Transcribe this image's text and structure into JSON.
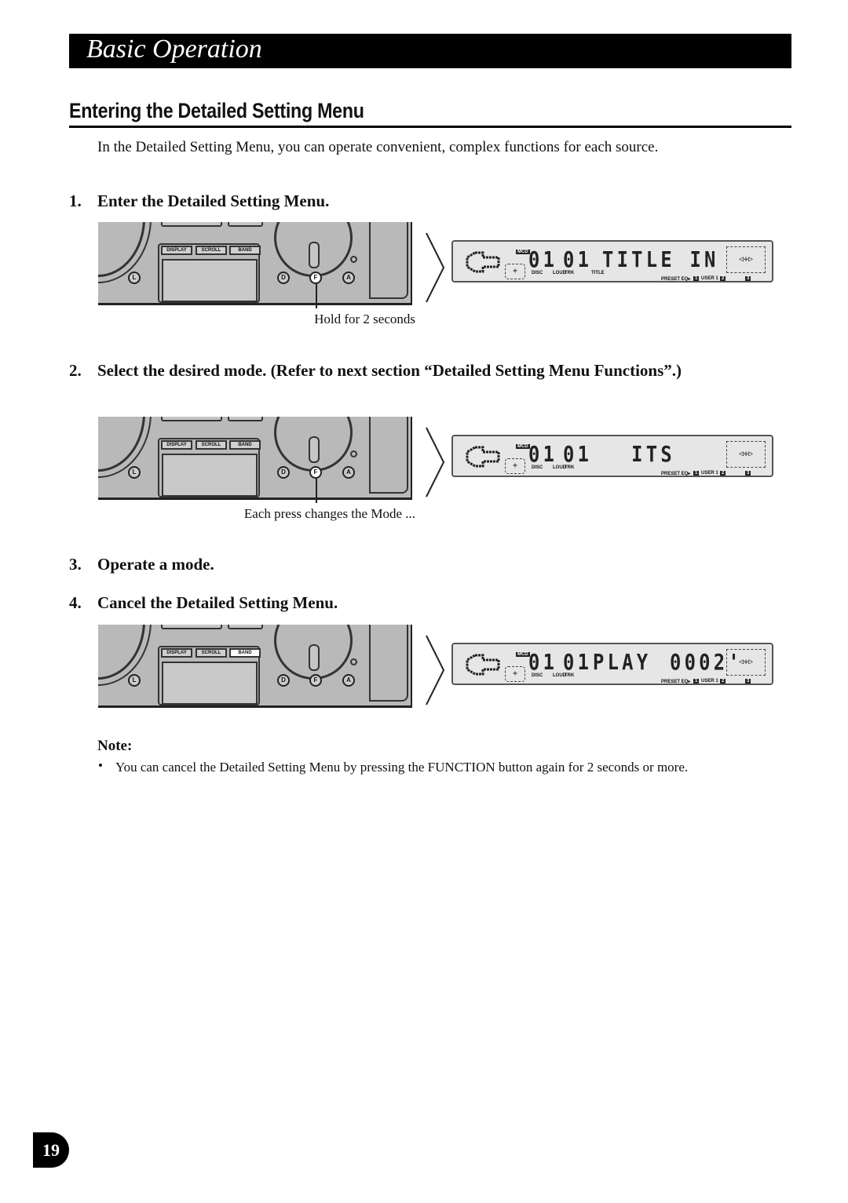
{
  "header": {
    "title": "Basic Operation"
  },
  "section": {
    "title": "Entering the Detailed Setting Menu"
  },
  "intro": "In the Detailed Setting Menu, you can operate convenient, complex functions for each source.",
  "steps": [
    {
      "num": "1.",
      "text": "Enter the Detailed Setting Menu."
    },
    {
      "num": "2.",
      "text": "Select the desired mode. (Refer to next section “Detailed Setting Menu Functions”.)"
    },
    {
      "num": "3.",
      "text": "Operate a mode."
    },
    {
      "num": "4.",
      "text": "Cancel the Detailed Setting Menu."
    }
  ],
  "panel": {
    "display": "DISPLAY",
    "scroll": "SCROLL",
    "band": "BAND",
    "l": "L",
    "d": "D",
    "f": "F",
    "a": "A"
  },
  "figures": [
    {
      "caption": "Hold for 2 seconds",
      "disc": "01",
      "track": "01",
      "main": "TITLE IN",
      "time": "",
      "labels": [
        "DISC",
        "LOUD",
        "TRK",
        "TITLE"
      ],
      "highlight": "f"
    },
    {
      "caption": "Each press changes the Mode ...",
      "disc": "01",
      "track": "01",
      "main": "  ITS",
      "time": "",
      "labels": [
        "DISC",
        "LOUD",
        "TRK"
      ],
      "highlight": "f"
    },
    {
      "caption": "",
      "disc": "01",
      "track": "01",
      "main": "PLAY",
      "time": "0002'",
      "labels": [
        "DISC",
        "LOUD",
        "TRK"
      ],
      "highlight": "band"
    }
  ],
  "lcd": {
    "mcd": "MCD",
    "preset": "PRESET EQ▸",
    "n1": "1",
    "user": "USER 1",
    "n2": "2",
    "n3": "3"
  },
  "note": {
    "title": "Note:",
    "bullet": "•",
    "text": "You can cancel the Detailed Setting Menu by pressing the FUNCTION button again for 2 seconds or more."
  },
  "page_number": "19"
}
